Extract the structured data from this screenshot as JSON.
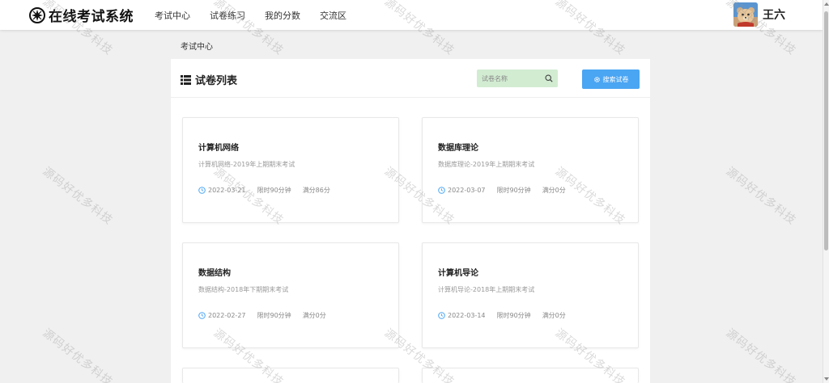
{
  "header": {
    "title": "在线考试系统",
    "nav": [
      {
        "label": "考试中心"
      },
      {
        "label": "试卷练习"
      },
      {
        "label": "我的分数"
      },
      {
        "label": "交流区"
      }
    ],
    "user": {
      "name": "王六"
    }
  },
  "breadcrumb": "考试中心",
  "panel": {
    "title": "试卷列表",
    "search_placeholder": "试卷名称",
    "search_button": "搜索试卷"
  },
  "cards": [
    {
      "title": "计算机网络",
      "desc": "计算机网络-2019年上期期末考试",
      "date": "2022-03-21",
      "time_limit": "限时90分钟",
      "full_score": "满分86分"
    },
    {
      "title": "数据库理论",
      "desc": "数据库理论-2019年上期期末考试",
      "date": "2022-03-07",
      "time_limit": "限时90分钟",
      "full_score": "满分0分"
    },
    {
      "title": "数据结构",
      "desc": "数据结构-2018年下期期末考试",
      "date": "2022-02-27",
      "time_limit": "限时90分钟",
      "full_score": "满分0分"
    },
    {
      "title": "计算机导论",
      "desc": "计算机导论-2018年上期期末考试",
      "date": "2022-03-14",
      "time_limit": "限时90分钟",
      "full_score": "满分0分"
    }
  ],
  "watermark": "源码好优多科技",
  "colors": {
    "accent": "#4aa5f3",
    "search_bg": "#d2ecd2",
    "page_bg": "#f0f0f0"
  }
}
